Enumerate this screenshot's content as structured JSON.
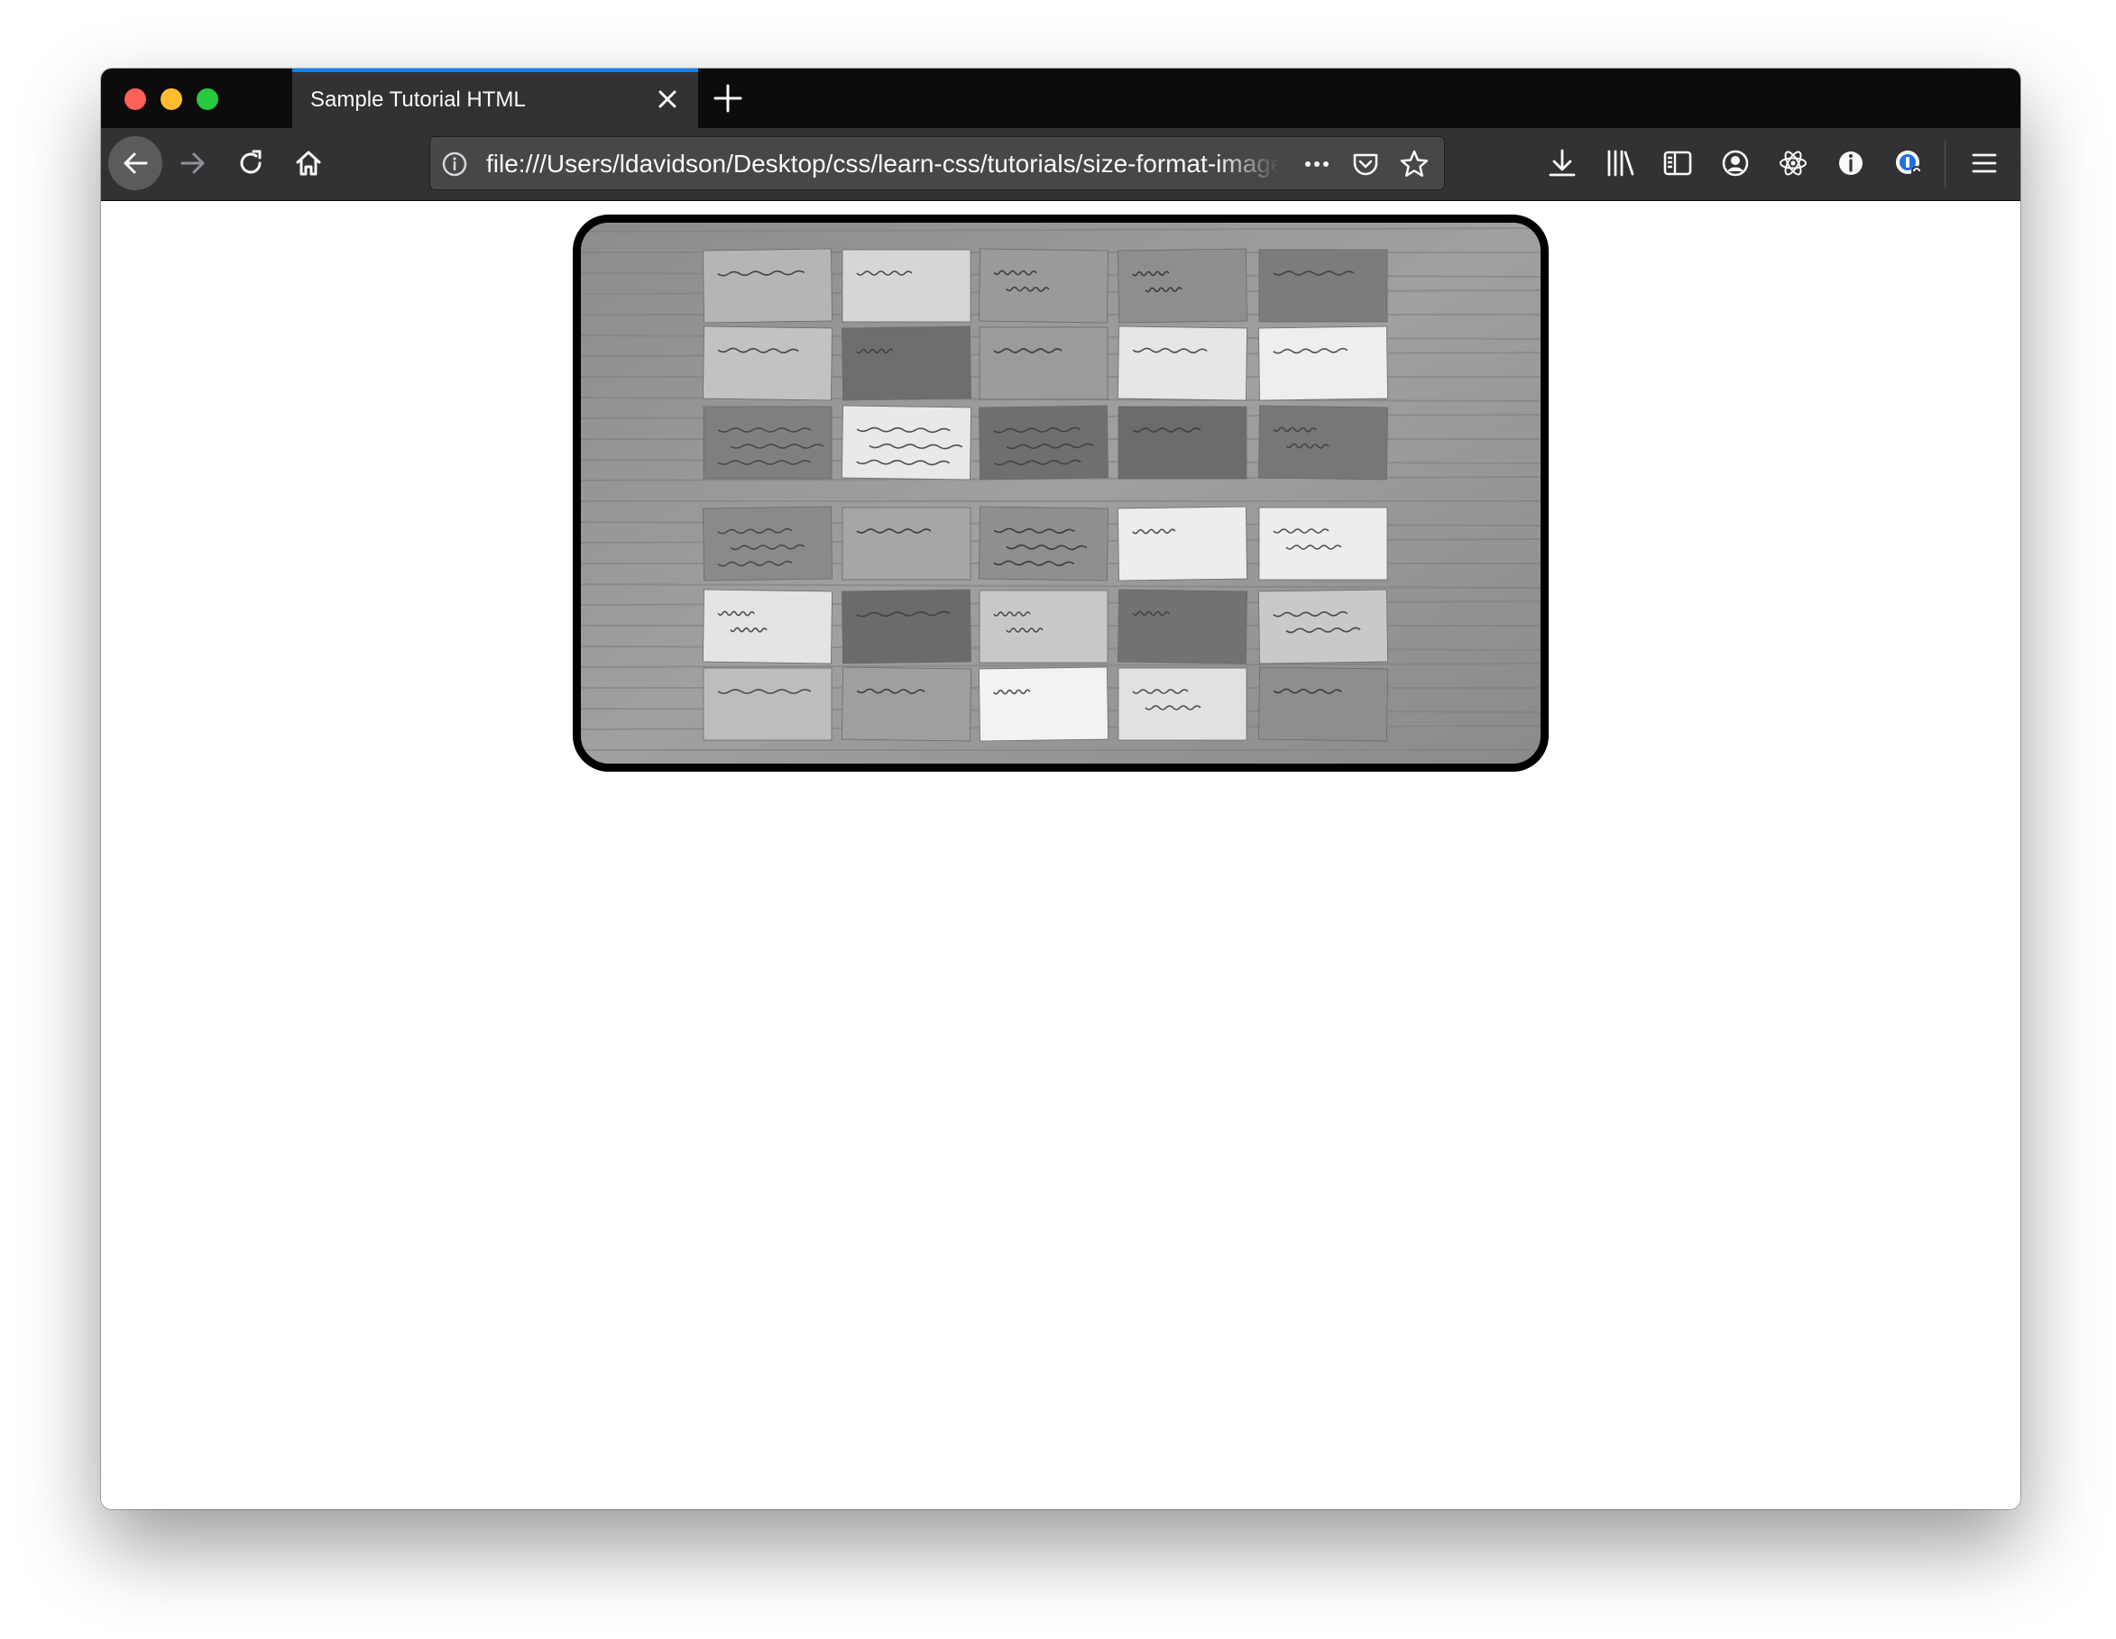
{
  "browser": {
    "tab": {
      "title": "Sample Tutorial HTML"
    },
    "address_bar": {
      "url": "file:///Users/ldavidson/Desktop/css/learn-css/tutorials/size-format-image"
    }
  },
  "icons": {
    "window_controls": [
      "close-window-icon",
      "minimize-window-icon",
      "maximize-window-icon"
    ],
    "tab": [
      "close-tab-icon",
      "new-tab-icon"
    ],
    "navigation": [
      "back-icon",
      "forward-icon",
      "reload-icon",
      "home-icon"
    ],
    "address_bar": [
      "info-icon",
      "more-icon",
      "pocket-icon",
      "bookmark-star-icon"
    ],
    "toolbar": [
      "downloads-icon",
      "library-icon",
      "sidebar-icon",
      "account-icon",
      "react-devtools-icon",
      "info-extension-icon",
      "password-manager-icon",
      "menu-icon"
    ]
  },
  "photo": {
    "description_cards": [
      [
        "aesthetics = style",
        "(your) SCHELL",
        "word of the day: \"antimetabole\"",
        "academic works generate demand",
        "UNKNOWN"
      ],
      [
        "Story = relevance",
        "AESTHETICS",
        "Scale",
        "classroom · game",
        "KNOWN."
      ],
      [
        "Short vs. long game - Draw attention to the scale",
        "GAMES for the CLASSROOM vs. the CLASSROOM as GAME",
        "Applying game elements to teaching prompts thinking about overall elements I might have overlooked",
        "STORY",
        "Projective identities"
      ],
      [
        "Overlap in the tetrad: aesthetics vs story mechanics vs technology",
        "tech → mechanics",
        "there are different scales in terms of teaching: course / term / classroom / one lesson",
        "(not) SHELL",
        "Short game vs long game"
      ],
      [
        "1. games as design experiences",
        "MECHANICS",
        "Mechanics = protocol",
        "TECHNOLOGY",
        "Technology = mechanics (?)"
      ],
      [
        "2. Chance",
        "3. time & space",
        "",
        "interactive experiences",
        "Scale"
      ]
    ]
  }
}
